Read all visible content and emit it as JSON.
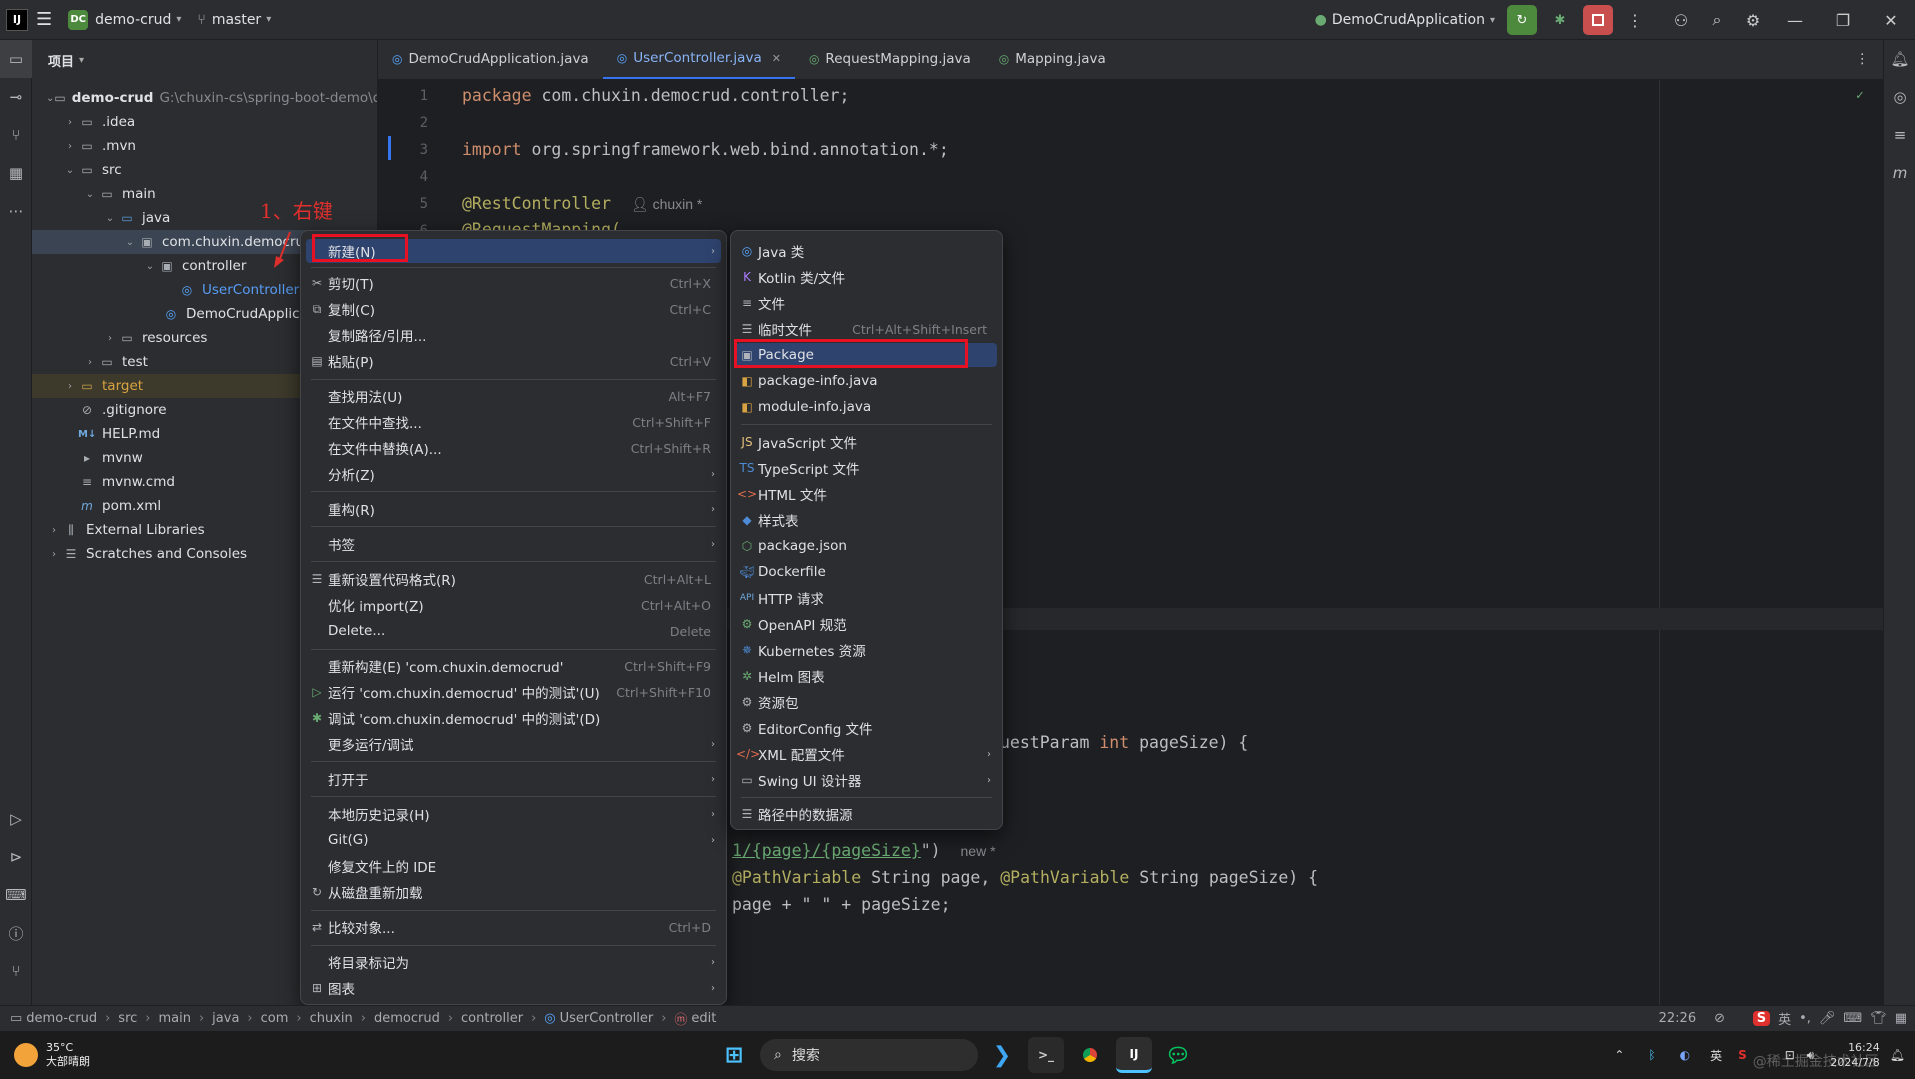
{
  "titlebar": {
    "project_badge": "DC",
    "project_name": "demo-crud",
    "branch": "master",
    "run_config": "DemoCrudApplication"
  },
  "project_panel": {
    "title": "项目",
    "root_name": "demo-crud",
    "root_path": "G:\\chuxin-cs\\spring-boot-demo\\d",
    "items": [
      {
        "label": ".idea"
      },
      {
        "label": ".mvn"
      },
      {
        "label": "src"
      },
      {
        "label": "main"
      },
      {
        "label": "java"
      },
      {
        "label": "com.chuxin.democrud"
      },
      {
        "label": "controller"
      },
      {
        "label": "UserController"
      },
      {
        "label": "DemoCrudApplica"
      },
      {
        "label": "resources"
      },
      {
        "label": "test"
      },
      {
        "label": "target"
      },
      {
        "label": ".gitignore"
      },
      {
        "label": "HELP.md"
      },
      {
        "label": "mvnw"
      },
      {
        "label": "mvnw.cmd"
      },
      {
        "label": "pom.xml"
      },
      {
        "label": "External Libraries"
      },
      {
        "label": "Scratches and Consoles"
      }
    ],
    "annotation": "1、右键"
  },
  "tabs": [
    {
      "label": "DemoCrudApplication.java"
    },
    {
      "label": "UserController.java"
    },
    {
      "label": "RequestMapping.java"
    },
    {
      "label": "Mapping.java"
    }
  ],
  "editor": {
    "line_numbers": [
      "1",
      "2",
      "3",
      "4",
      "5",
      "6"
    ],
    "line1_kw": "package",
    "line1_rest": " com.chuxin.democrud.controller;",
    "line3_kw": "import",
    "line3_rest": " org.springframework.web.bind.annotation.*;",
    "line5_ann": "@RestController",
    "line5_hint": "chuxin *",
    "line6": "@RequestMapping(",
    "frag1_rest": "uestParam ",
    "frag1_kw": "int",
    "frag1_tail": " pageSize) {",
    "frag2_str": "1/{page}/{pageSize}",
    "frag2_tail": "\")",
    "frag2_hint": "new *",
    "frag3_ann1": "@PathVariable",
    "frag3_mid": " String page, ",
    "frag3_ann2": "@PathVariable",
    "frag3_tail": " String pageSize) {",
    "frag4": "page + \" \" + pageSize;"
  },
  "context_menu": {
    "items": [
      {
        "label": "新建(N)",
        "shortcut": ""
      },
      {
        "label": "剪切(T)",
        "shortcut": "Ctrl+X"
      },
      {
        "label": "复制(C)",
        "shortcut": "Ctrl+C"
      },
      {
        "label": "复制路径/引用...",
        "shortcut": ""
      },
      {
        "label": "粘贴(P)",
        "shortcut": "Ctrl+V"
      },
      {
        "label": "查找用法(U)",
        "shortcut": "Alt+F7"
      },
      {
        "label": "在文件中查找...",
        "shortcut": "Ctrl+Shift+F"
      },
      {
        "label": "在文件中替换(A)...",
        "shortcut": "Ctrl+Shift+R"
      },
      {
        "label": "分析(Z)",
        "shortcut": ""
      },
      {
        "label": "重构(R)",
        "shortcut": ""
      },
      {
        "label": "书签",
        "shortcut": ""
      },
      {
        "label": "重新设置代码格式(R)",
        "shortcut": "Ctrl+Alt+L"
      },
      {
        "label": "优化 import(Z)",
        "shortcut": "Ctrl+Alt+O"
      },
      {
        "label": "Delete...",
        "shortcut": "Delete"
      },
      {
        "label": "重新构建(E) 'com.chuxin.democrud'",
        "shortcut": "Ctrl+Shift+F9"
      },
      {
        "label": "运行 'com.chuxin.democrud' 中的测试'(U)",
        "shortcut": "Ctrl+Shift+F10"
      },
      {
        "label": "调试 'com.chuxin.democrud' 中的测试'(D)",
        "shortcut": ""
      },
      {
        "label": "更多运行/调试",
        "shortcut": ""
      },
      {
        "label": "打开于",
        "shortcut": ""
      },
      {
        "label": "本地历史记录(H)",
        "shortcut": ""
      },
      {
        "label": "Git(G)",
        "shortcut": ""
      },
      {
        "label": "修复文件上的 IDE",
        "shortcut": ""
      },
      {
        "label": "从磁盘重新加载",
        "shortcut": ""
      },
      {
        "label": "比较对象...",
        "shortcut": "Ctrl+D"
      },
      {
        "label": "将目录标记为",
        "shortcut": ""
      },
      {
        "label": "图表",
        "shortcut": ""
      }
    ]
  },
  "submenu": {
    "items": [
      {
        "label": "Java 类",
        "shortcut": ""
      },
      {
        "label": "Kotlin 类/文件",
        "shortcut": ""
      },
      {
        "label": "文件",
        "shortcut": ""
      },
      {
        "label": "临时文件",
        "shortcut": "Ctrl+Alt+Shift+Insert"
      },
      {
        "label": "Package",
        "shortcut": ""
      },
      {
        "label": "package-info.java",
        "shortcut": ""
      },
      {
        "label": "module-info.java",
        "shortcut": ""
      },
      {
        "label": "JavaScript 文件",
        "shortcut": ""
      },
      {
        "label": "TypeScript 文件",
        "shortcut": ""
      },
      {
        "label": "HTML 文件",
        "shortcut": ""
      },
      {
        "label": "样式表",
        "shortcut": ""
      },
      {
        "label": "package.json",
        "shortcut": ""
      },
      {
        "label": "Dockerfile",
        "shortcut": ""
      },
      {
        "label": "HTTP 请求",
        "shortcut": ""
      },
      {
        "label": "OpenAPI 规范",
        "shortcut": ""
      },
      {
        "label": "Kubernetes 资源",
        "shortcut": ""
      },
      {
        "label": "Helm 图表",
        "shortcut": ""
      },
      {
        "label": "资源包",
        "shortcut": ""
      },
      {
        "label": "EditorConfig 文件",
        "shortcut": ""
      },
      {
        "label": "XML 配置文件",
        "shortcut": ""
      },
      {
        "label": "Swing UI 设计器",
        "shortcut": ""
      },
      {
        "label": "路径中的数据源",
        "shortcut": ""
      }
    ]
  },
  "statusbar": {
    "breadcrumbs": [
      "demo-crud",
      "src",
      "main",
      "java",
      "com",
      "chuxin",
      "democrud",
      "controller",
      "UserController",
      "edit"
    ],
    "position": "22:26",
    "ime": "英"
  },
  "taskbar": {
    "temperature": "35°C",
    "weather": "大部晴朗",
    "search": "搜索",
    "time": "16:24",
    "date": "2024/7/8",
    "lang": "英",
    "watermark": "@稀土掘金技术社区"
  }
}
